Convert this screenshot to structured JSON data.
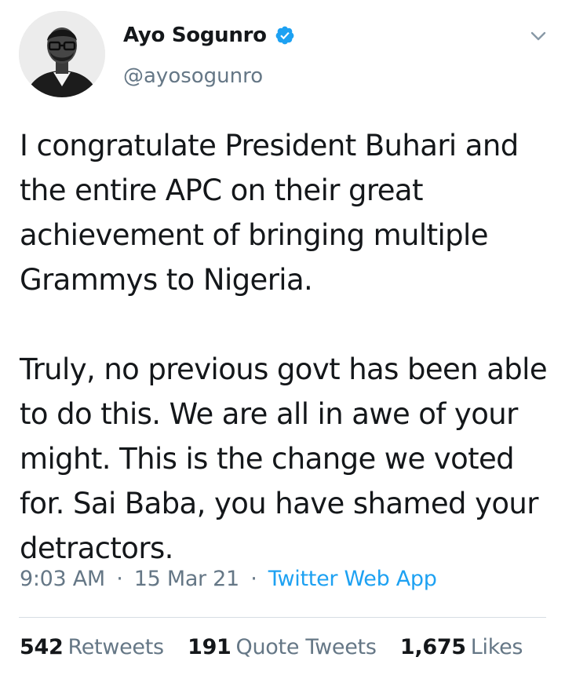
{
  "tweet": {
    "author": {
      "display_name": "Ayo Sogunro",
      "handle": "@ayosogunro",
      "verified": true
    },
    "paragraphs": [
      "I congratulate President Buhari and the entire APC on their great achievement of bringing multiple Grammys to Nigeria.",
      "Truly, no previous govt has been able to do this. We are all in awe of your might. This is the change we voted for. Sai Baba, you have shamed your detractors."
    ],
    "time": "9:03 AM",
    "date": "15 Mar 21",
    "separator": "·",
    "source": "Twitter Web App",
    "stats": {
      "retweets": {
        "count": "542",
        "label": "Retweets"
      },
      "quote_tweets": {
        "count": "191",
        "label": "Quote Tweets"
      },
      "likes": {
        "count": "1,675",
        "label": "Likes"
      }
    }
  },
  "icons": {
    "verified": "verified-badge-icon",
    "more": "chevron-down-icon"
  },
  "colors": {
    "text": "#14171a",
    "secondary": "#657786",
    "accent": "#1da1f2",
    "divider": "#d6dde3"
  }
}
